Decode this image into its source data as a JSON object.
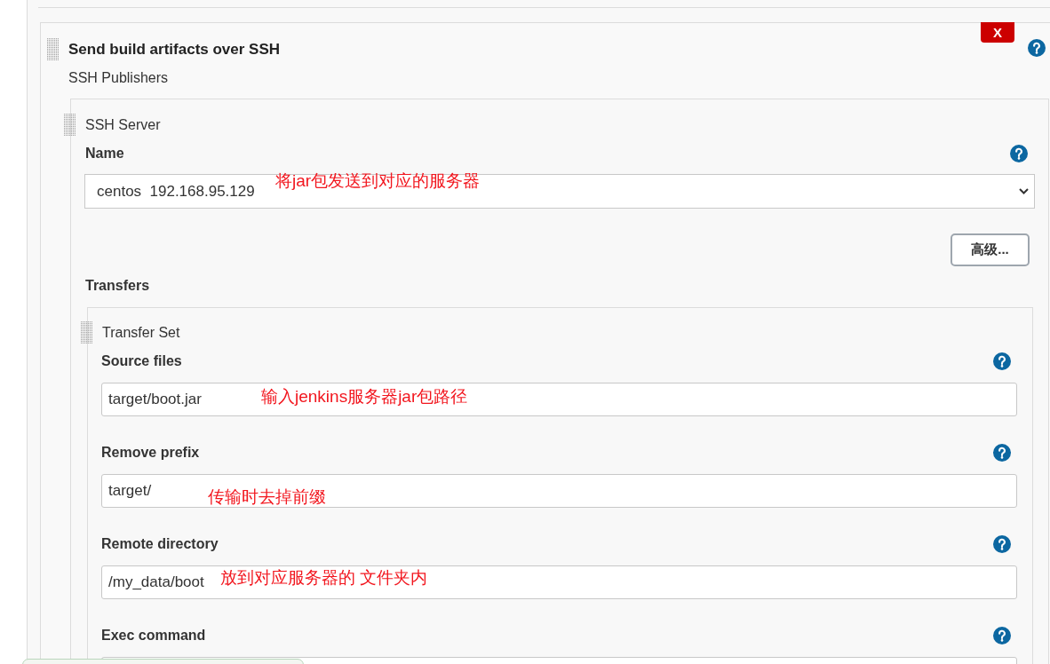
{
  "post_build_step": {
    "title": "Send build artifacts over SSH",
    "delete_button": "X",
    "subtitle": "SSH Publishers",
    "ssh_server": {
      "title": "SSH Server",
      "name_field": {
        "label": "Name",
        "value": "centos  192.168.95.129",
        "annotation": "将jar包发送到对应的服务器"
      },
      "advanced_button": "高级...",
      "transfers_label": "Transfers",
      "transfer_set": {
        "title": "Transfer Set",
        "fields": [
          {
            "label": "Source files",
            "value": "target/boot.jar",
            "annotation": "输入jenkins服务器jar包路径"
          },
          {
            "label": "Remove prefix",
            "value": "target/",
            "annotation": "传输时去掉前缀"
          },
          {
            "label": "Remote directory",
            "value": "/my_data/boot",
            "annotation": "放到对应服务器的 文件夹内"
          },
          {
            "label": "Exec command"
          }
        ]
      }
    }
  }
}
